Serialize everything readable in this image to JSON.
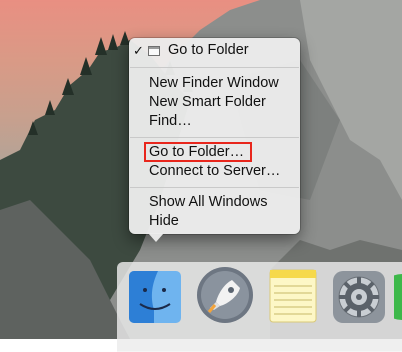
{
  "context_menu": {
    "header_item": {
      "label": "Go to Folder",
      "checked": true,
      "icon": "window-icon"
    },
    "group1": [
      "New Finder Window",
      "New Smart Folder",
      "Find…"
    ],
    "group2": [
      "Go to Folder…",
      "Connect to Server…"
    ],
    "group3": [
      "Show All Windows",
      "Hide"
    ],
    "highlighted_item": "Go to Folder…",
    "highlight_color": "#e8261c"
  },
  "dock": {
    "apps": [
      {
        "name": "Finder",
        "icon": "finder-icon"
      },
      {
        "name": "Launchpad",
        "icon": "launchpad-rocket-icon"
      },
      {
        "name": "Notes",
        "icon": "notes-icon"
      },
      {
        "name": "System Preferences",
        "icon": "system-preferences-gear-icon"
      }
    ]
  }
}
